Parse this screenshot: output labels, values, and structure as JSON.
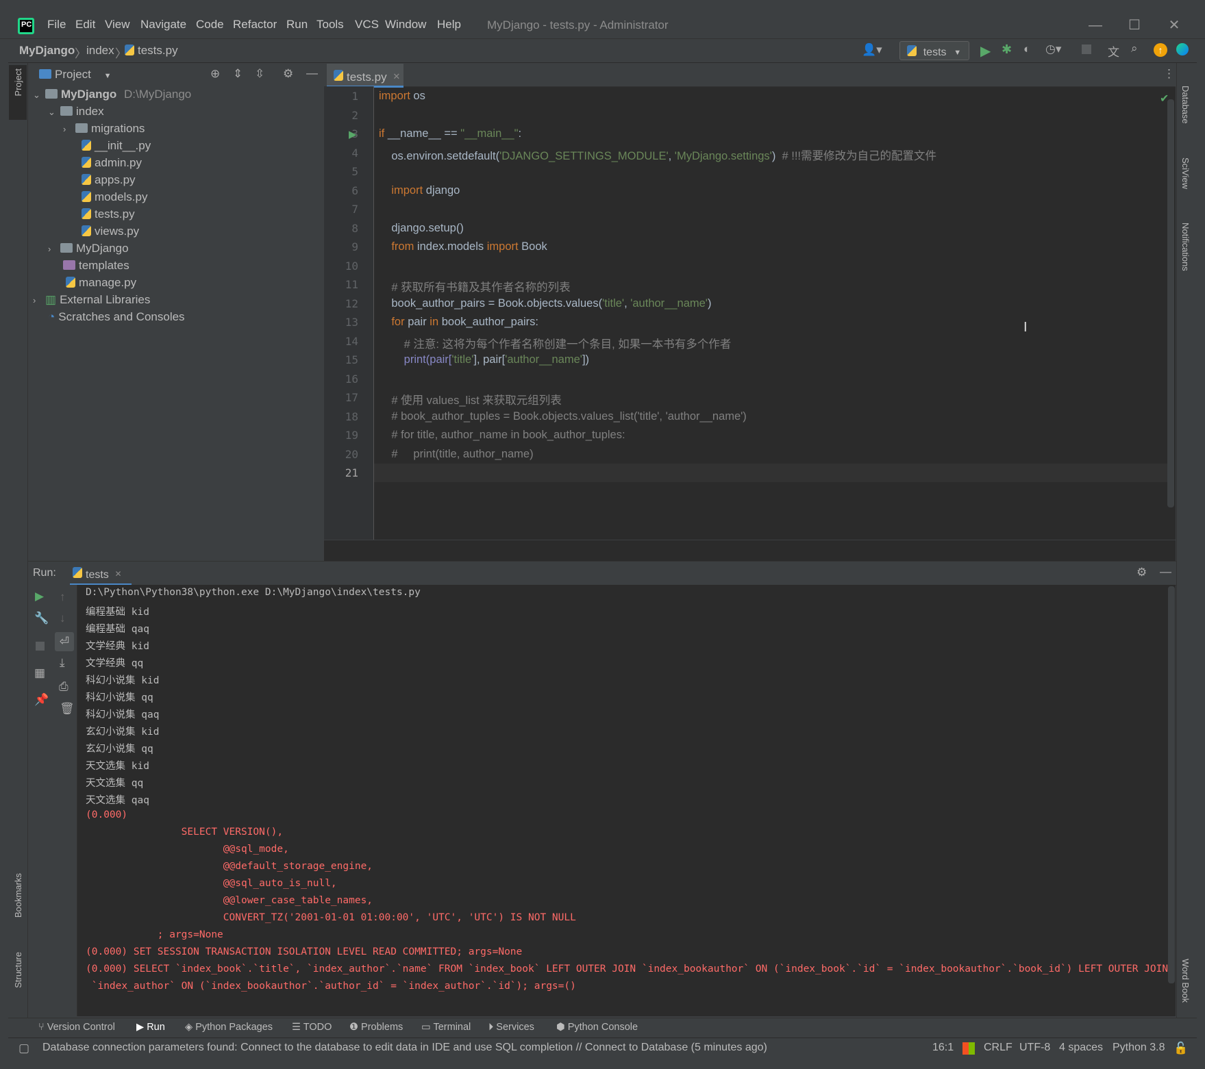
{
  "window": {
    "title": "MyDjango - tests.py - Administrator",
    "menu": [
      "File",
      "Edit",
      "View",
      "Navigate",
      "Code",
      "Refactor",
      "Run",
      "Tools",
      "VCS",
      "Window",
      "Help"
    ]
  },
  "nav": {
    "crumbs": [
      "MyDjango",
      "index",
      "tests.py"
    ],
    "run_config": "tests"
  },
  "left_strip": {
    "project": "Project",
    "bookmarks": "Bookmarks",
    "structure": "Structure"
  },
  "right_strip": {
    "database": "Database",
    "sciview": "SciView",
    "notifications": "Notifications",
    "wordbook": "Word Book"
  },
  "project_panel": {
    "title": "Project",
    "root": "MyDjango",
    "root_path": "D:\\MyDjango",
    "items": [
      "index",
      "migrations",
      "__init__.py",
      "admin.py",
      "apps.py",
      "models.py",
      "tests.py",
      "views.py",
      "MyDjango",
      "templates",
      "manage.py",
      "External Libraries",
      "Scratches and Consoles"
    ]
  },
  "editor": {
    "tab": "tests.py",
    "line_numbers": [
      "1",
      "2",
      "3",
      "4",
      "5",
      "6",
      "7",
      "8",
      "9",
      "10",
      "11",
      "12",
      "13",
      "14",
      "15",
      "16",
      "17",
      "18",
      "19",
      "20",
      "21"
    ],
    "t": {
      "import": "import",
      "os": " os",
      "if": "if",
      "name_eq": " __name__ == ",
      "main_str": "\"__main__\"",
      "colon": ":",
      "environ": "    os.environ.setdefault(",
      "s_settings_module": "'DJANGO_SETTINGS_MODULE'",
      "comma": ", ",
      "s_settings": "'MyDjango.settings'",
      "close_paren_sp": ")  ",
      "c_note": "# !!!需要修改为自己的配置文件",
      "indent4": "    ",
      "django": " django",
      "setup": "    django.setup()",
      "from": "from",
      "index_models": " index.models ",
      "book": " Book",
      "c_get_all": "    # 获取所有书籍及其作者名称的列表",
      "pairs_assign": "    book_author_pairs = Book.objects.values(",
      "s_title": "'title'",
      "s_author_name": "'author__name'",
      "close_paren": ")",
      "for": "for",
      "pair": " pair ",
      "in": "in",
      "pairs_colon": " book_author_pairs:",
      "c_note2": "        # 注意: 这将为每个作者名称创建一个条目, 如果一本书有多个作者",
      "print_open": "        print(pair[",
      "bracket_comma": "], pair[",
      "close_br": "])",
      "c_use_vl": "    # 使用 values_list 来获取元组列表",
      "c_tuples": "    # book_author_tuples = Book.objects.values_list('title', 'author__name')",
      "c_for": "    # for title, author_name in book_author_tuples:",
      "c_print": "    #     print(title, author_name)"
    }
  },
  "run": {
    "label": "Run:",
    "tab": "tests",
    "output": [
      "D:\\Python\\Python38\\python.exe D:\\MyDjango\\index\\tests.py",
      "编程基础 kid",
      "编程基础 qaq",
      "文学经典 kid",
      "文学经典 qq",
      "科幻小说集 kid",
      "科幻小说集 qq",
      "科幻小说集 qaq",
      "玄幻小说集 kid",
      "玄幻小说集 qq",
      "天文选集 kid",
      "天文选集 qq",
      "天文选集 qaq"
    ],
    "sql": [
      "(0.000)",
      "                SELECT VERSION(),",
      "                       @@sql_mode,",
      "                       @@default_storage_engine,",
      "                       @@sql_auto_is_null,",
      "                       @@lower_case_table_names,",
      "                       CONVERT_TZ('2001-01-01 01:00:00', 'UTC', 'UTC') IS NOT NULL",
      "            ; args=None",
      "(0.000) SET SESSION TRANSACTION ISOLATION LEVEL READ COMMITTED; args=None",
      "(0.000) SELECT `index_book`.`title`, `index_author`.`name` FROM `index_book` LEFT OUTER JOIN `index_bookauthor` ON (`index_book`.`id` = `index_bookauthor`.`book_id`) LEFT OUTER JOIN",
      " `index_author` ON (`index_bookauthor`.`author_id` = `index_author`.`id`); args=()"
    ]
  },
  "toolwindows": [
    "Version Control",
    "Run",
    "Python Packages",
    "TODO",
    "Problems",
    "Terminal",
    "Services",
    "Python Console"
  ],
  "status": {
    "message": "Database connection parameters found: Connect to the database to edit data in IDE and use SQL completion // Connect to Database (5 minutes ago)",
    "position": "16:1",
    "line_sep": "CRLF",
    "encoding": "UTF-8",
    "indent": "4 spaces",
    "interpreter": "Python 3.8"
  },
  "colors": {
    "keyword": "#cc7832",
    "string": "#6a8759",
    "comment": "#808080",
    "sql_red": "#ff6b68",
    "run_green": "#59a869",
    "accent": "#21d789"
  }
}
